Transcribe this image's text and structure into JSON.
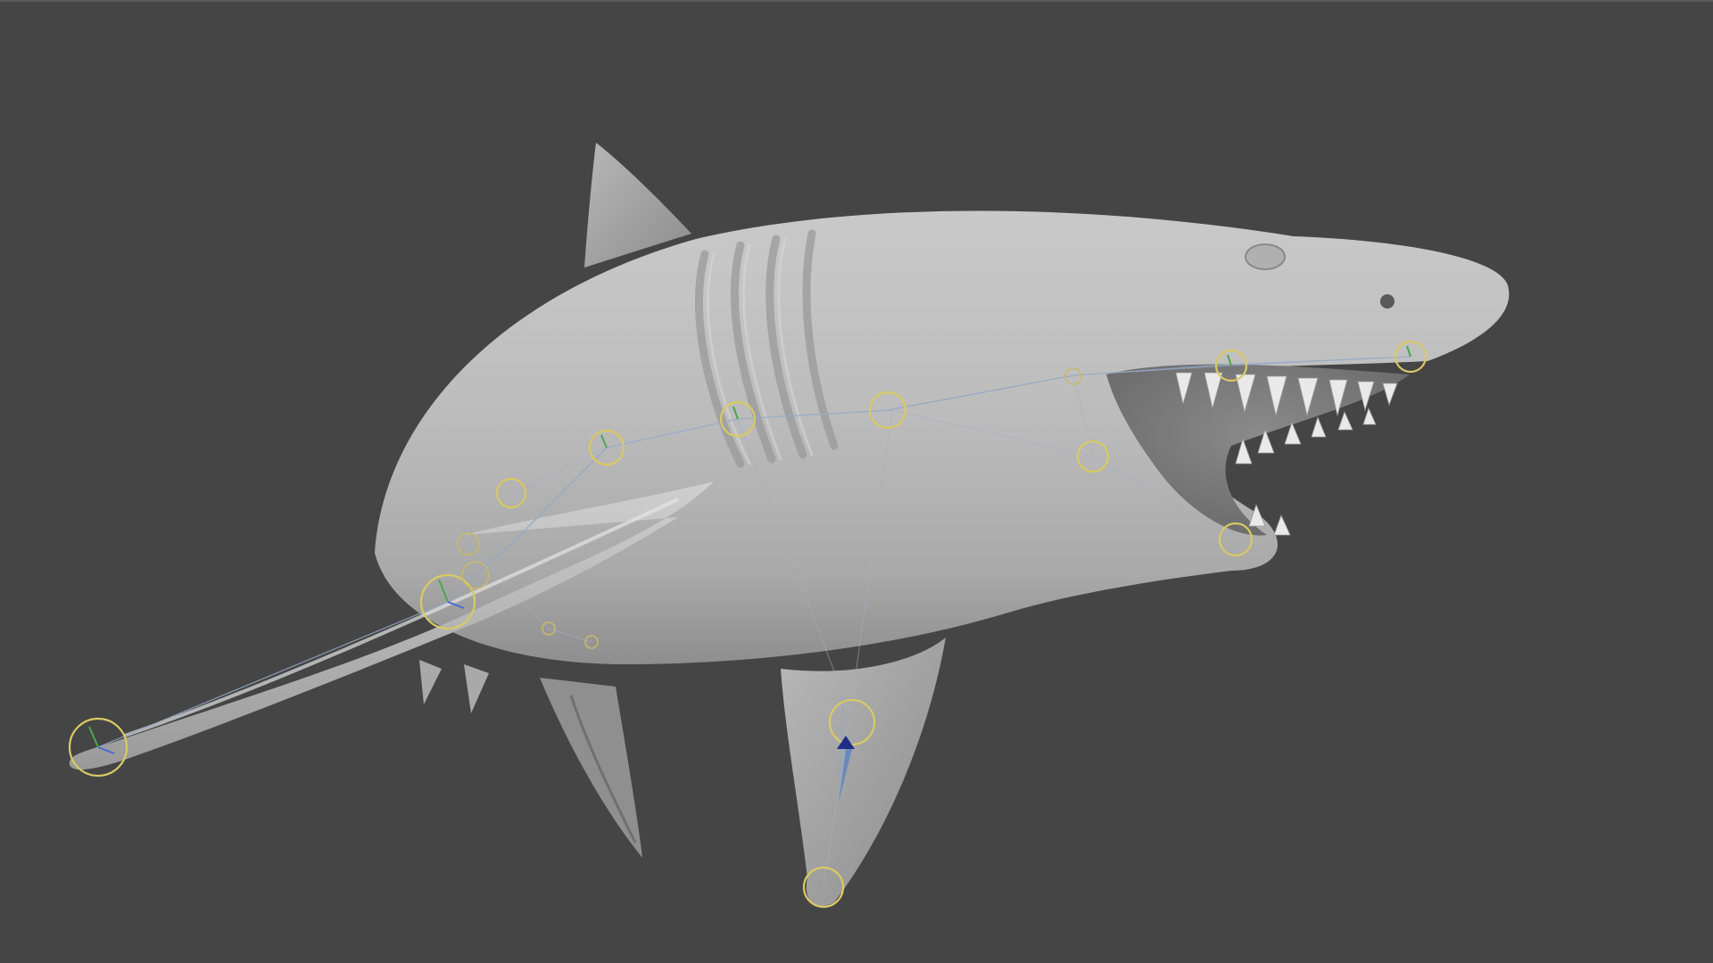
{
  "viewport": {
    "background_color": "#454545",
    "model_color": "#bdbdbd",
    "joint_color": "#d9c964",
    "bone_color": "#8fa7c4",
    "subject": "shark-model-with-rig"
  }
}
